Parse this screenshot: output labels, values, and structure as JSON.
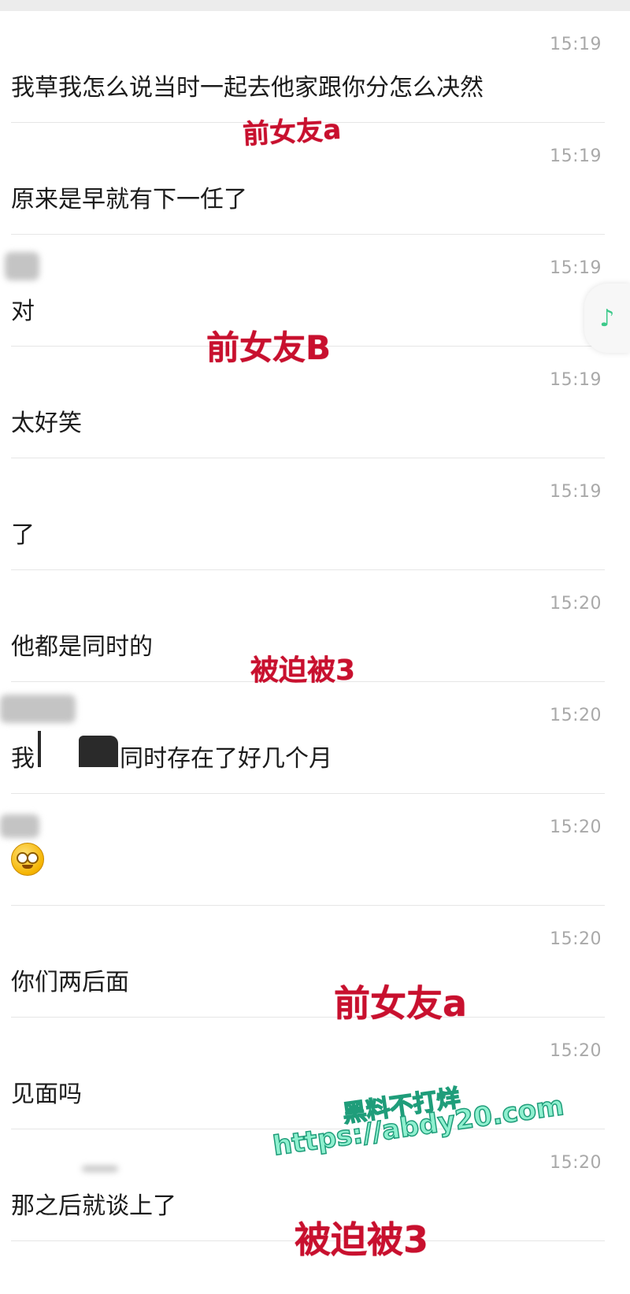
{
  "messages": [
    {
      "time": "15:19",
      "text": "我草我怎么说当时一起去他家跟你分怎么决然"
    },
    {
      "time": "15:19",
      "text": "原来是早就有下一任了"
    },
    {
      "time": "15:19",
      "text": "对"
    },
    {
      "time": "15:19",
      "text": "太好笑"
    },
    {
      "time": "15:19",
      "text": "了"
    },
    {
      "time": "15:20",
      "text": "他都是同时的"
    },
    {
      "time": "15:20",
      "text_a": "我",
      "text_b": "同时存在了好几个月"
    },
    {
      "time": "15:20",
      "emoji": "flushed-face-emoji"
    },
    {
      "time": "15:20",
      "text": "你们两后面"
    },
    {
      "time": "15:20",
      "text": "见面吗"
    },
    {
      "time": "15:20",
      "text": "那之后就谈上了"
    }
  ],
  "annotations": {
    "a1": "前女友a",
    "b1": "前女友B",
    "c1": "被迫被3",
    "a2": "前女友a",
    "c2": "被迫被3"
  },
  "watermark": {
    "line1": "黑料不打烊",
    "line2": "https://abdy20.com"
  },
  "music_icon": "music-note-icon",
  "colors": {
    "annotation": "#c8102e",
    "watermark": "#8ff0cf",
    "music_note": "#3cc98a"
  }
}
